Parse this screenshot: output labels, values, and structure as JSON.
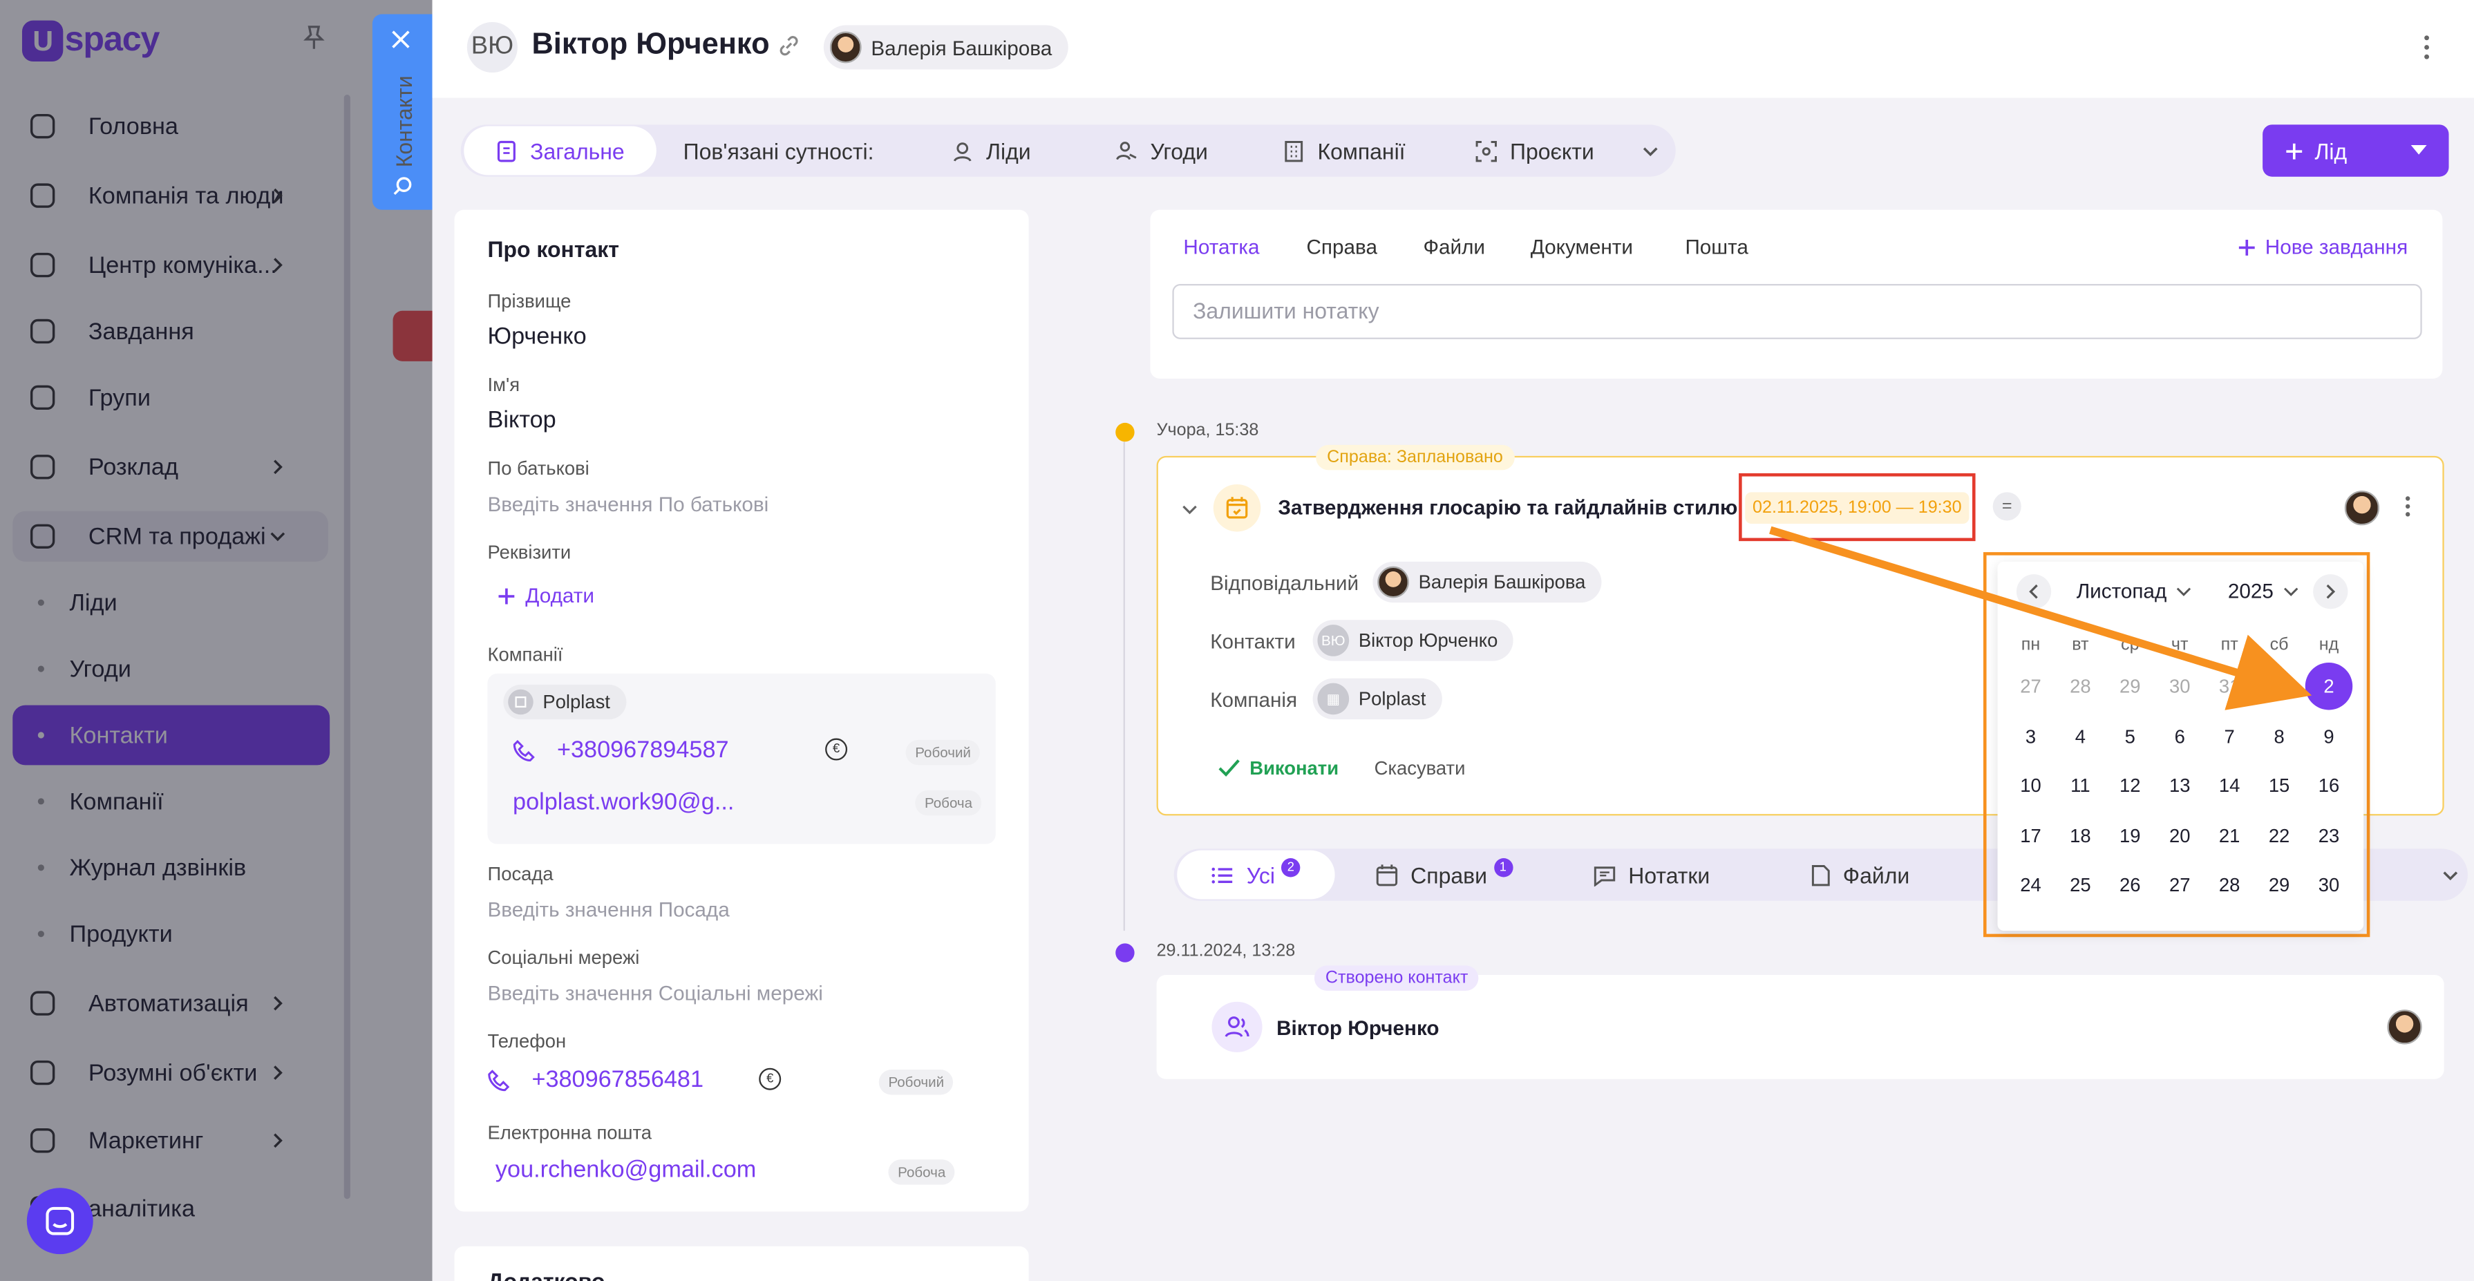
{
  "sidebar": {
    "logo": "spacy",
    "logo_mark": "U",
    "items": [
      {
        "label": "Головна",
        "icon": "home-icon"
      },
      {
        "label": "Компанія та люди",
        "icon": "building-icon"
      },
      {
        "label": "Центр комуніка...",
        "icon": "chat-icon"
      },
      {
        "label": "Завдання",
        "icon": "check-circle-icon"
      },
      {
        "label": "Групи",
        "icon": "users-icon"
      },
      {
        "label": "Розклад",
        "icon": "calendar-icon"
      },
      {
        "label": "CRM та продажі",
        "icon": "crm-icon"
      },
      {
        "label": "Автоматизація",
        "icon": "bolt-icon"
      },
      {
        "label": "Розумні об'єкти",
        "icon": "scan-icon"
      },
      {
        "label": "Маркетинг",
        "icon": "megaphone-icon"
      },
      {
        "label": "аналітика",
        "icon": "chart-icon"
      }
    ],
    "crm_sub": [
      "Ліди",
      "Угоди",
      "Контакти",
      "Компанії",
      "Журнал дзвінків",
      "Продукти"
    ],
    "active_sub": "Контакти"
  },
  "vtab": {
    "label": "Контакти"
  },
  "header": {
    "initials": "ВЮ",
    "title": "Віктор Юрченко",
    "responsible": "Валерія Башкірова"
  },
  "tabs": {
    "general": "Загальне",
    "related_label": "Пов'язані сутності:",
    "leads": "Ліди",
    "deals": "Угоди",
    "companies": "Компанії",
    "projects": "Проєкти"
  },
  "lead_button": "Лід",
  "about": {
    "title": "Про контакт",
    "surname_label": "Прізвище",
    "surname": "Юрченко",
    "name_label": "Ім'я",
    "name": "Віктор",
    "patronymic_label": "По батькові",
    "patronymic_placeholder": "Введіть значення По батькові",
    "requisites_label": "Реквізити",
    "add": "Додати",
    "companies_label": "Компанії",
    "company_name": "Polplast",
    "company_phone": "+380967894587",
    "company_phone_type": "Робочий",
    "company_email": "polplast.work90@g...",
    "company_email_type": "Робоча",
    "position_label": "Посада",
    "position_placeholder": "Введіть значення Посада",
    "social_label": "Соціальні мережі",
    "social_placeholder": "Введіть значення Соціальні мережі",
    "phone_label": "Телефон",
    "phone": "+380967856481",
    "phone_type": "Робочий",
    "email_label": "Електронна пошта",
    "email": "you.rchenko@gmail.com",
    "email_type": "Робоча",
    "more_title": "Додатково"
  },
  "note": {
    "tabs": [
      "Нотатка",
      "Справа",
      "Файли",
      "Документи",
      "Пошта"
    ],
    "new_task": "Нове завдання",
    "placeholder": "Залишити нотатку"
  },
  "timeline": {
    "item1_date": "Учора, 15:38",
    "item1_tag": "Справа: Заплановано",
    "task_title": "Затвердження глосарію та гайдлайнів стилю",
    "task_date": "02.11.2025, 19:00 — 19:30",
    "eq": "=",
    "responsible_label": "Відповідальний",
    "responsible": "Валерія Башкірова",
    "contacts_label": "Контакти",
    "contact_initials": "ВЮ",
    "contact": "Віктор Юрченко",
    "company_label": "Компанія",
    "company": "Polplast",
    "done": "Виконати",
    "cancel": "Скасувати",
    "item2_date": "29.11.2024, 13:28",
    "item2_tag": "Створено контакт",
    "item2_name": "Віктор Юрченко"
  },
  "filters": {
    "all": "Усі",
    "all_count": "2",
    "tasks": "Справи",
    "tasks_count": "1",
    "notes": "Нотатки",
    "files": "Файли"
  },
  "calendar": {
    "month": "Листопад",
    "year": "2025",
    "weekdays": [
      "пн",
      "вт",
      "ср",
      "чт",
      "пт",
      "сб",
      "нд"
    ],
    "weeks": [
      [
        "27",
        "28",
        "29",
        "30",
        "31",
        "1",
        "2"
      ],
      [
        "3",
        "4",
        "5",
        "6",
        "7",
        "8",
        "9"
      ],
      [
        "10",
        "11",
        "12",
        "13",
        "14",
        "15",
        "16"
      ],
      [
        "17",
        "18",
        "19",
        "20",
        "21",
        "22",
        "23"
      ],
      [
        "24",
        "25",
        "26",
        "27",
        "28",
        "29",
        "30"
      ]
    ],
    "selected": "2"
  },
  "colors": {
    "accent": "#7a3cf0",
    "warning": "#f2a10d",
    "annotation_red": "#e33b2e",
    "annotation_orange": "#f7911f"
  }
}
